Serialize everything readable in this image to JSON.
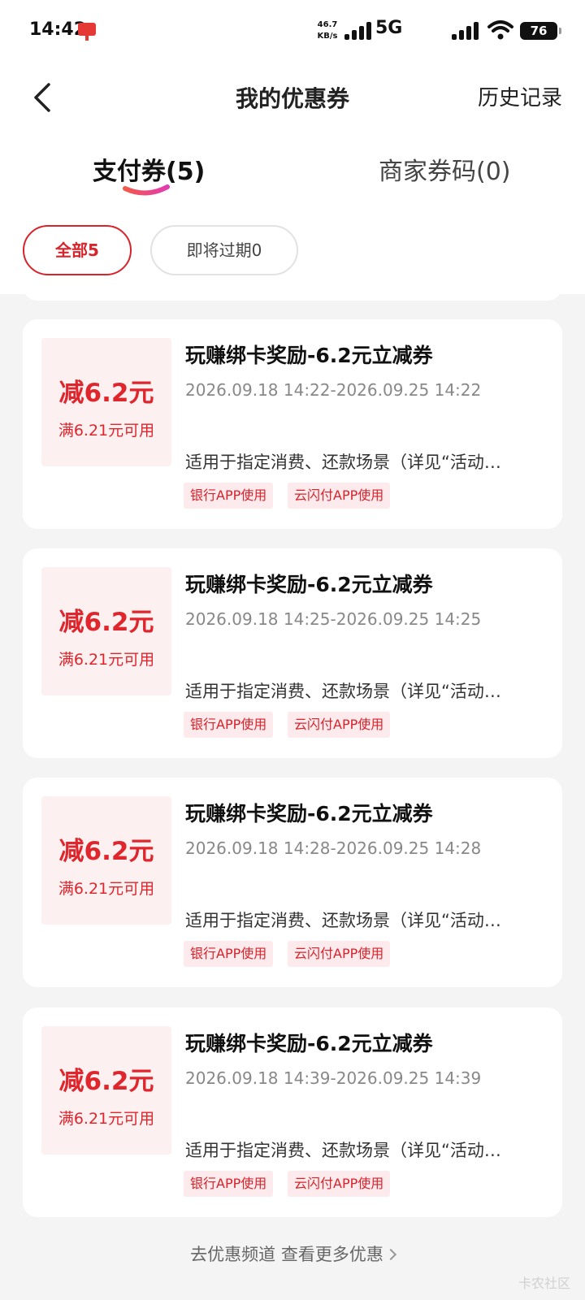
{
  "status_bar": {
    "time": "14:42",
    "net_speed_value": "46.7",
    "net_speed_unit": "KB/s",
    "network": "5G",
    "battery": "76",
    "icons": [
      "app-notification-icon",
      "signal-icon",
      "wifi-icon",
      "battery-icon"
    ]
  },
  "header": {
    "title": "我的优惠券",
    "history": "历史记录"
  },
  "tabs": [
    {
      "label": "支付券(5)",
      "active": true
    },
    {
      "label": "商家券码(0)",
      "active": false
    }
  ],
  "filters": [
    {
      "label": "全部5",
      "active": true
    },
    {
      "label": "即将过期0",
      "active": false
    }
  ],
  "coupons": [
    {
      "amount": "减6.2元",
      "condition": "满6.21元可用",
      "title": "玩赚绑卡奖励-6.2元立减券",
      "period": "2026.09.18 14:22-2026.09.25 14:22",
      "desc": "适用于指定消费、还款场景（详见“活动…",
      "tags": [
        "银行APP使用",
        "云闪付APP使用"
      ]
    },
    {
      "amount": "减6.2元",
      "condition": "满6.21元可用",
      "title": "玩赚绑卡奖励-6.2元立减券",
      "period": "2026.09.18 14:25-2026.09.25 14:25",
      "desc": "适用于指定消费、还款场景（详见“活动…",
      "tags": [
        "银行APP使用",
        "云闪付APP使用"
      ]
    },
    {
      "amount": "减6.2元",
      "condition": "满6.21元可用",
      "title": "玩赚绑卡奖励-6.2元立减券",
      "period": "2026.09.18 14:28-2026.09.25 14:28",
      "desc": "适用于指定消费、还款场景（详见“活动…",
      "tags": [
        "银行APP使用",
        "云闪付APP使用"
      ]
    },
    {
      "amount": "减6.2元",
      "condition": "满6.21元可用",
      "title": "玩赚绑卡奖励-6.2元立减券",
      "period": "2026.09.18 14:39-2026.09.25 14:39",
      "desc": "适用于指定消费、还款场景（详见“活动…",
      "tags": [
        "银行APP使用",
        "云闪付APP使用"
      ]
    }
  ],
  "footer": {
    "link": "去优惠频道 查看更多优惠"
  },
  "watermark": "卡农社区",
  "colors": {
    "accent": "#d8232a",
    "amount_bg": "#fdf0f1",
    "tag_bg": "#fdeaec",
    "page_bg": "#f4f4f4"
  }
}
